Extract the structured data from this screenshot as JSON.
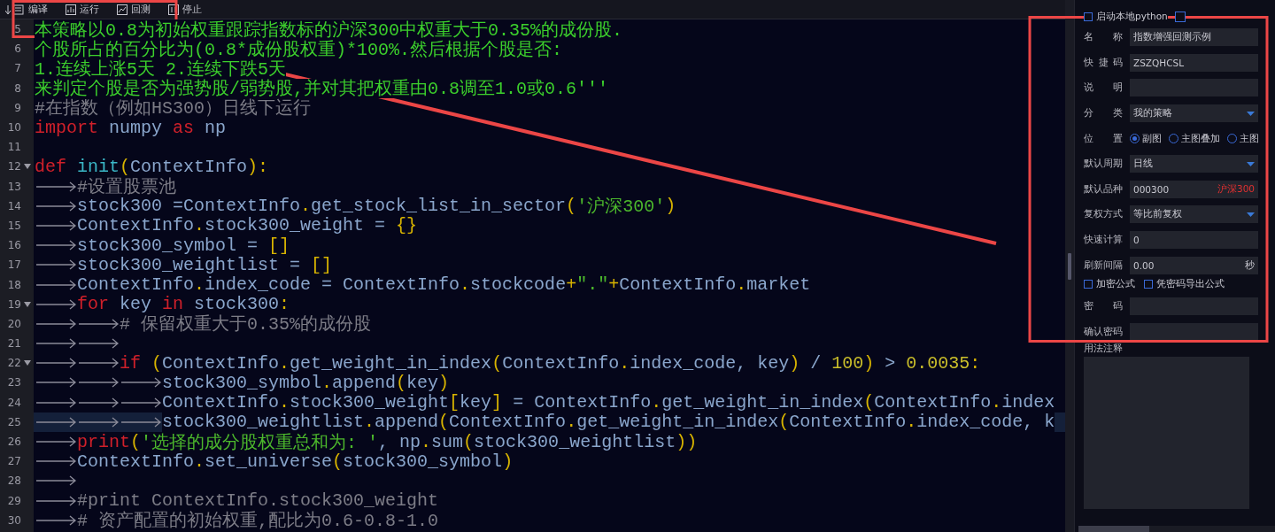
{
  "toolbar": [
    {
      "label": "编译"
    },
    {
      "label": "运行"
    },
    {
      "label": "回测"
    },
    {
      "label": "停止"
    }
  ],
  "editor": {
    "lines": [
      {
        "number": "5",
        "tokens": [
          {
            "kind": "doc",
            "text": "本策略以0.8为初始权重跟踪指数标的沪深300中权重大于0.35%的成份股."
          }
        ]
      },
      {
        "number": "6",
        "tokens": [
          {
            "kind": "doc",
            "text": "个股所占的百分比为(0.8*成份股权重)*100%.然后根据个股是否:"
          }
        ]
      },
      {
        "number": "7",
        "tokens": [
          {
            "kind": "doc",
            "text": "1.连续上涨5天 2.连续下跌5天"
          }
        ]
      },
      {
        "number": "8",
        "tokens": [
          {
            "kind": "doc",
            "text": "来判定个股是否为强势股/弱势股,并对其把权重由0.8调至1.0或0.6'''"
          }
        ]
      },
      {
        "number": "9",
        "tokens": [
          {
            "kind": "comment",
            "text": "#在指数（例如HS300）日线下运行"
          }
        ]
      },
      {
        "number": "10",
        "tokens": [
          {
            "kind": "keyword",
            "text": "import"
          },
          {
            "kind": "name",
            "text": " numpy "
          },
          {
            "kind": "keyword",
            "text": "as"
          },
          {
            "kind": "name",
            "text": " np"
          }
        ]
      },
      {
        "number": "11"
      },
      {
        "number": "12",
        "fold": true,
        "tokens": [
          {
            "kind": "keyword",
            "text": "def "
          },
          {
            "kind": "function",
            "text": "init"
          },
          {
            "kind": "punct",
            "text": "("
          },
          {
            "kind": "name",
            "text": "ContextInfo"
          },
          {
            "kind": "punct",
            "text": "):"
          }
        ]
      },
      {
        "number": "13",
        "tokens": [
          {
            "kind": "tab"
          },
          {
            "kind": "comment",
            "text": "#设置股票池"
          }
        ]
      },
      {
        "number": "14",
        "tokens": [
          {
            "kind": "tab"
          },
          {
            "kind": "name",
            "text": "stock300 =ContextInfo"
          },
          {
            "kind": "punct",
            "text": "."
          },
          {
            "kind": "name",
            "text": "get_stock_list_in_sector"
          },
          {
            "kind": "punct",
            "text": "("
          },
          {
            "kind": "string",
            "text": "'沪深300'"
          },
          {
            "kind": "punct",
            "text": ")"
          }
        ]
      },
      {
        "number": "15",
        "tokens": [
          {
            "kind": "tab"
          },
          {
            "kind": "name",
            "text": "ContextInfo"
          },
          {
            "kind": "punct",
            "text": "."
          },
          {
            "kind": "name",
            "text": "stock300_weight = "
          },
          {
            "kind": "punct",
            "text": "{}"
          }
        ]
      },
      {
        "number": "16",
        "tokens": [
          {
            "kind": "tab"
          },
          {
            "kind": "name",
            "text": "stock300_symbol = "
          },
          {
            "kind": "punct",
            "text": "[]"
          }
        ]
      },
      {
        "number": "17",
        "tokens": [
          {
            "kind": "tab"
          },
          {
            "kind": "name",
            "text": "stock300_weightlist = "
          },
          {
            "kind": "punct",
            "text": "[]"
          }
        ]
      },
      {
        "number": "18",
        "tokens": [
          {
            "kind": "tab"
          },
          {
            "kind": "name",
            "text": "ContextInfo"
          },
          {
            "kind": "punct",
            "text": "."
          },
          {
            "kind": "name",
            "text": "index_code = ContextInfo"
          },
          {
            "kind": "punct",
            "text": "."
          },
          {
            "kind": "name",
            "text": "stockcode"
          },
          {
            "kind": "punct",
            "text": "+"
          },
          {
            "kind": "string",
            "text": "\".\""
          },
          {
            "kind": "punct",
            "text": "+"
          },
          {
            "kind": "name",
            "text": "ContextInfo"
          },
          {
            "kind": "punct",
            "text": "."
          },
          {
            "kind": "name",
            "text": "market"
          }
        ]
      },
      {
        "number": "19",
        "fold": true,
        "tokens": [
          {
            "kind": "tab"
          },
          {
            "kind": "keyword",
            "text": "for"
          },
          {
            "kind": "name",
            "text": " key "
          },
          {
            "kind": "keyword",
            "text": "in"
          },
          {
            "kind": "name",
            "text": " stock300"
          },
          {
            "kind": "punct",
            "text": ":"
          }
        ]
      },
      {
        "number": "20",
        "tokens": [
          {
            "kind": "tab"
          },
          {
            "kind": "tab"
          },
          {
            "kind": "comment",
            "text": "# 保留权重大于0.35%的成份股"
          }
        ]
      },
      {
        "number": "21",
        "tokens": [
          {
            "kind": "tab"
          },
          {
            "kind": "tab"
          }
        ]
      },
      {
        "number": "22",
        "fold": true,
        "tokens": [
          {
            "kind": "tab"
          },
          {
            "kind": "tab"
          },
          {
            "kind": "keyword",
            "text": "if "
          },
          {
            "kind": "punct",
            "text": "("
          },
          {
            "kind": "name",
            "text": "ContextInfo"
          },
          {
            "kind": "punct",
            "text": "."
          },
          {
            "kind": "name",
            "text": "get_weight_in_index"
          },
          {
            "kind": "punct",
            "text": "("
          },
          {
            "kind": "name",
            "text": "ContextInfo"
          },
          {
            "kind": "punct",
            "text": "."
          },
          {
            "kind": "name",
            "text": "index_code, key"
          },
          {
            "kind": "punct",
            "text": ")"
          },
          {
            "kind": "name",
            "text": " / "
          },
          {
            "kind": "number",
            "text": "100"
          },
          {
            "kind": "punct",
            "text": ")"
          },
          {
            "kind": "name",
            "text": " > "
          },
          {
            "kind": "number",
            "text": "0.0035"
          },
          {
            "kind": "punct",
            "text": ":"
          }
        ]
      },
      {
        "number": "23",
        "tokens": [
          {
            "kind": "tab"
          },
          {
            "kind": "tab"
          },
          {
            "kind": "tab"
          },
          {
            "kind": "name",
            "text": "stock300_symbol"
          },
          {
            "kind": "punct",
            "text": "."
          },
          {
            "kind": "name",
            "text": "append"
          },
          {
            "kind": "punct",
            "text": "("
          },
          {
            "kind": "name",
            "text": "key"
          },
          {
            "kind": "punct",
            "text": ")"
          }
        ]
      },
      {
        "number": "24",
        "tokens": [
          {
            "kind": "tab"
          },
          {
            "kind": "tab"
          },
          {
            "kind": "tab"
          },
          {
            "kind": "name",
            "text": "ContextInfo"
          },
          {
            "kind": "punct",
            "text": "."
          },
          {
            "kind": "name",
            "text": "stock300_weight"
          },
          {
            "kind": "punct",
            "text": "["
          },
          {
            "kind": "name",
            "text": "key"
          },
          {
            "kind": "punct",
            "text": "]"
          },
          {
            "kind": "name",
            "text": " = ContextInfo"
          },
          {
            "kind": "punct",
            "text": "."
          },
          {
            "kind": "name",
            "text": "get_weight_in_index"
          },
          {
            "kind": "punct",
            "text": "("
          },
          {
            "kind": "name",
            "text": "ContextInfo"
          },
          {
            "kind": "punct",
            "text": "."
          },
          {
            "kind": "name",
            "text": "index"
          }
        ]
      },
      {
        "number": "25",
        "current": true,
        "tokens": [
          {
            "kind": "tab"
          },
          {
            "kind": "tab"
          },
          {
            "kind": "tab"
          },
          {
            "kind": "name",
            "text": "stock300_weightlist"
          },
          {
            "kind": "punct",
            "text": "."
          },
          {
            "kind": "name",
            "text": "append"
          },
          {
            "kind": "punct",
            "text": "("
          },
          {
            "kind": "name",
            "text": "ContextInfo"
          },
          {
            "kind": "punct",
            "text": "."
          },
          {
            "kind": "name",
            "text": "get_weight_in_index"
          },
          {
            "kind": "punct",
            "text": "("
          },
          {
            "kind": "name",
            "text": "ContextInfo"
          },
          {
            "kind": "punct",
            "text": "."
          },
          {
            "kind": "name",
            "text": "index_code, k"
          }
        ]
      },
      {
        "number": "26",
        "tokens": [
          {
            "kind": "tab"
          },
          {
            "kind": "keyword",
            "text": "print"
          },
          {
            "kind": "punct",
            "text": "("
          },
          {
            "kind": "string",
            "text": "'选择的成分股权重总和为: '"
          },
          {
            "kind": "name",
            "text": ", np"
          },
          {
            "kind": "punct",
            "text": "."
          },
          {
            "kind": "name",
            "text": "sum"
          },
          {
            "kind": "punct",
            "text": "("
          },
          {
            "kind": "name",
            "text": "stock300_weightlist"
          },
          {
            "kind": "punct",
            "text": "))"
          }
        ]
      },
      {
        "number": "27",
        "tokens": [
          {
            "kind": "tab"
          },
          {
            "kind": "name",
            "text": "ContextInfo"
          },
          {
            "kind": "punct",
            "text": "."
          },
          {
            "kind": "name",
            "text": "set_universe"
          },
          {
            "kind": "punct",
            "text": "("
          },
          {
            "kind": "name",
            "text": "stock300_symbol"
          },
          {
            "kind": "punct",
            "text": ")"
          }
        ]
      },
      {
        "number": "28",
        "tokens": [
          {
            "kind": "tab"
          }
        ]
      },
      {
        "number": "29",
        "tokens": [
          {
            "kind": "tab"
          },
          {
            "kind": "comment",
            "text": "#print ContextInfo.stock300_weight"
          }
        ]
      },
      {
        "number": "30",
        "tokens": [
          {
            "kind": "tab"
          },
          {
            "kind": "comment",
            "text": "# 资产配置的初始权重,配比为0.6-0.8-1.0"
          }
        ]
      }
    ]
  },
  "settings": {
    "top_option": {
      "label": "启动本地python",
      "checked": false
    },
    "fields": [
      {
        "kind": "text",
        "label": "名称",
        "value": "指数增强回测示例"
      },
      {
        "kind": "text",
        "label": "快捷码",
        "value": "ZSZQHCSL"
      },
      {
        "kind": "text",
        "label": "说明"
      },
      {
        "kind": "select",
        "label": "分类",
        "value": "我的策略"
      },
      {
        "kind": "radio",
        "label": "位置",
        "options": [
          {
            "label": "副图",
            "selected": true
          },
          {
            "label": "主图叠加",
            "selected": false
          },
          {
            "label": "主图",
            "selected": false
          }
        ]
      },
      {
        "kind": "select",
        "label": "默认周期",
        "value": "日线"
      },
      {
        "kind": "text",
        "label": "默认品种",
        "value": "000300",
        "note": "沪深300"
      },
      {
        "kind": "select",
        "label": "复权方式",
        "value": "等比前复权"
      },
      {
        "kind": "text",
        "label": "快速计算",
        "value": "0"
      },
      {
        "kind": "text",
        "label": "刷新间隔",
        "value": "0.00",
        "unit": "秒"
      },
      {
        "kind": "checks",
        "options": [
          {
            "label": "加密公式",
            "checked": false
          },
          {
            "label": "凭密码导出公式",
            "checked": false
          }
        ]
      },
      {
        "kind": "text",
        "label": "密码"
      },
      {
        "kind": "text",
        "label": "确认密码"
      },
      {
        "kind": "textarea",
        "label": "用法注释"
      }
    ]
  }
}
